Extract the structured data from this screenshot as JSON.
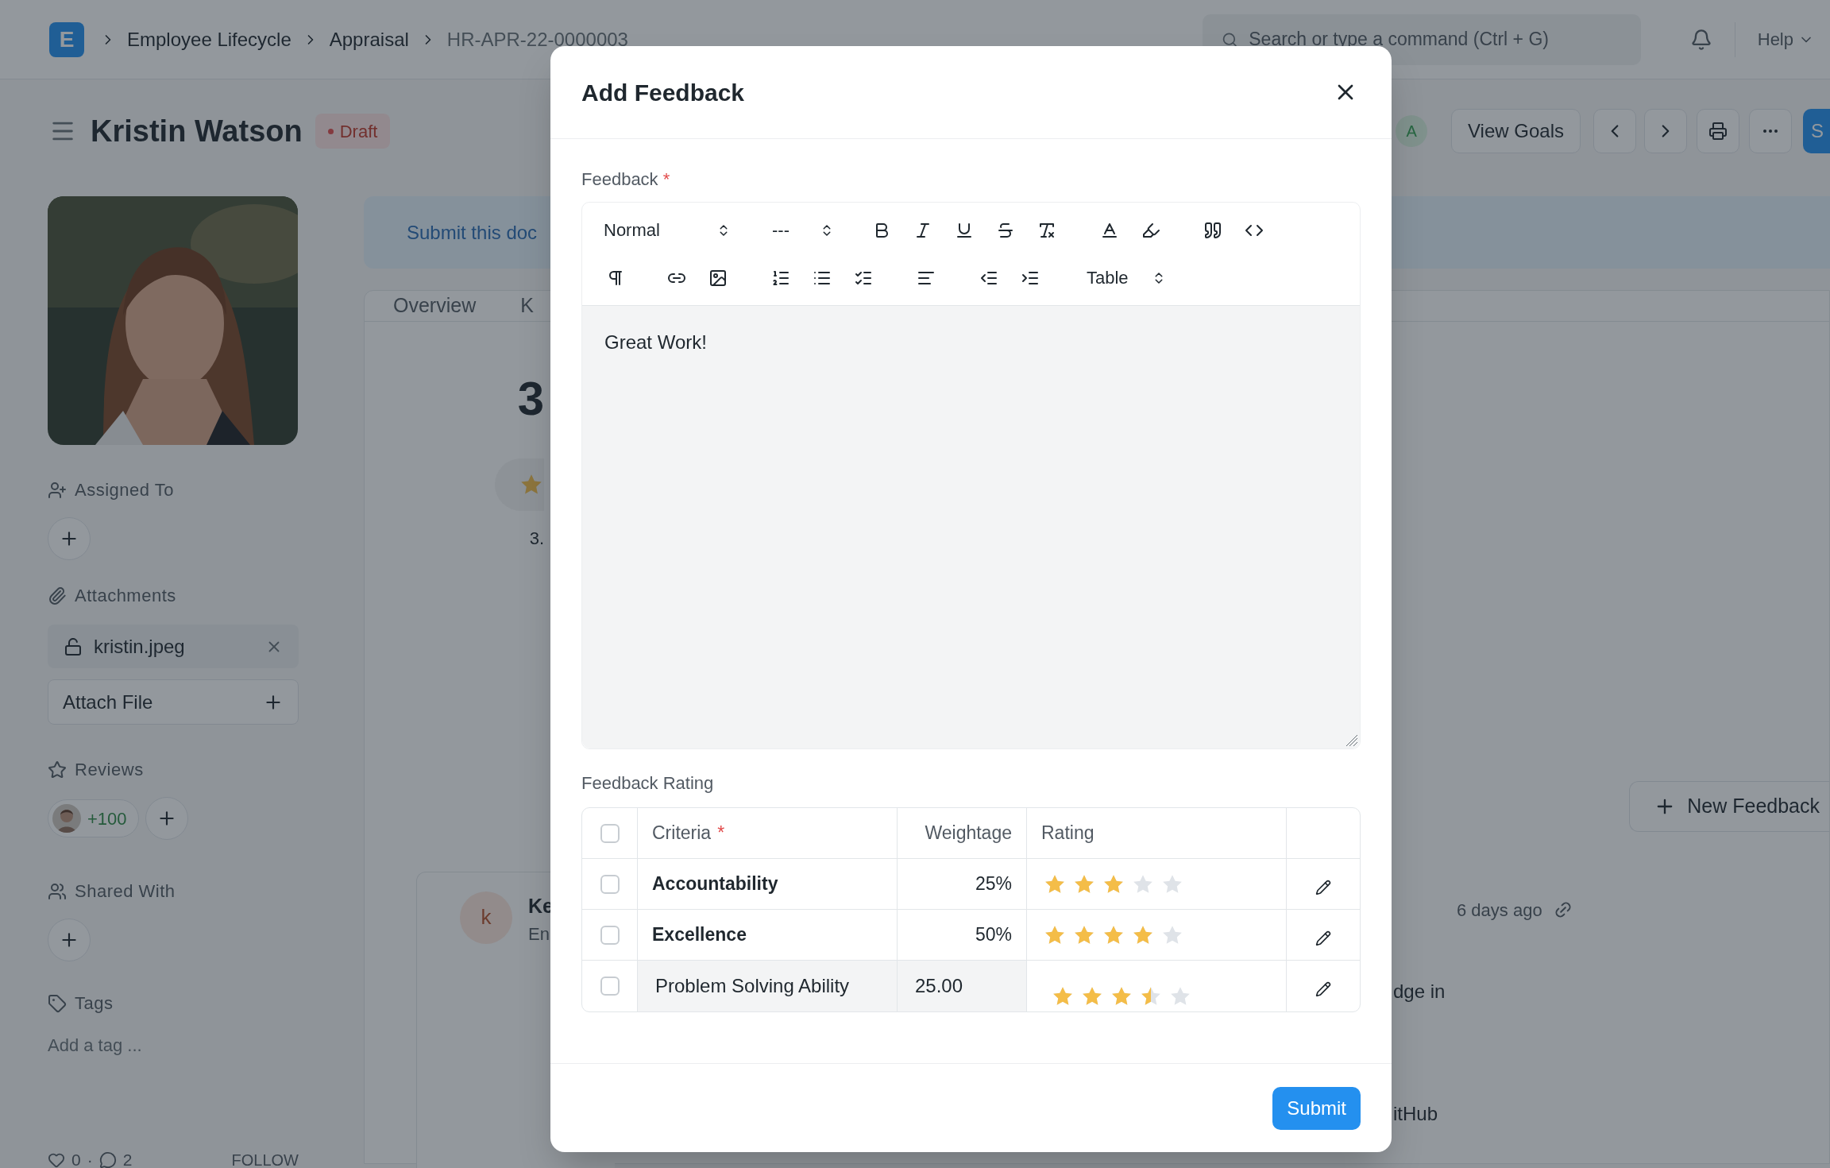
{
  "navbar": {
    "logo": "E",
    "breadcrumbs": [
      "Employee Lifecycle",
      "Appraisal",
      "HR-APR-22-0000003"
    ],
    "search": {
      "placeholder": "Search or type a command (Ctrl + G)"
    },
    "help": "Help"
  },
  "page_header": {
    "title": "Kristin Watson",
    "status": "Draft",
    "avatar": "A",
    "view_goals": "View Goals",
    "primary_button": "S"
  },
  "sidebar": {
    "assigned_to": "Assigned To",
    "attachments": {
      "label": "Attachments",
      "files": [
        "kristin.jpeg"
      ],
      "attach_button": "Attach File"
    },
    "reviews": {
      "label": "Reviews",
      "count": "+100"
    },
    "shared_with": "Shared With",
    "tags": {
      "label": "Tags",
      "placeholder": "Add a tag ..."
    },
    "footer": {
      "likes": "0",
      "separator": "·",
      "comments": "2",
      "follow": "FOLLOW"
    }
  },
  "banner": "Submit this doc",
  "tabs": [
    "Overview",
    "K"
  ],
  "rating_summary": {
    "score": "3",
    "caption": "3."
  },
  "feedback_section": {
    "new_button": "New Feedback",
    "card": {
      "avatar": "k",
      "name": "Ke",
      "subtitle": "En",
      "time": "6 days ago",
      "lines": [
        "dge in",
        "itHub"
      ]
    }
  },
  "modal": {
    "title": "Add Feedback",
    "feedback_label": "Feedback",
    "required_mark": "*",
    "toolbar": {
      "style_select": "Normal",
      "size_select": "---",
      "table_select": "Table"
    },
    "content": "Great Work!",
    "rating_label": "Feedback Rating",
    "table": {
      "header_checked": false,
      "columns": [
        {
          "label": "Criteria",
          "required_mark": "*"
        },
        {
          "label": "Weightage"
        },
        {
          "label": "Rating"
        }
      ],
      "rows": [
        {
          "checked": false,
          "editing": false,
          "criteria": "Accountability",
          "weightage": "25%",
          "stars": 3
        },
        {
          "checked": false,
          "editing": false,
          "criteria": "Excellence",
          "weightage": "50%",
          "stars": 4
        },
        {
          "checked": false,
          "editing": true,
          "criteria": "Problem Solving Ability",
          "weightage": "25.00",
          "stars": 3.5
        }
      ]
    },
    "submit": "Submit"
  }
}
